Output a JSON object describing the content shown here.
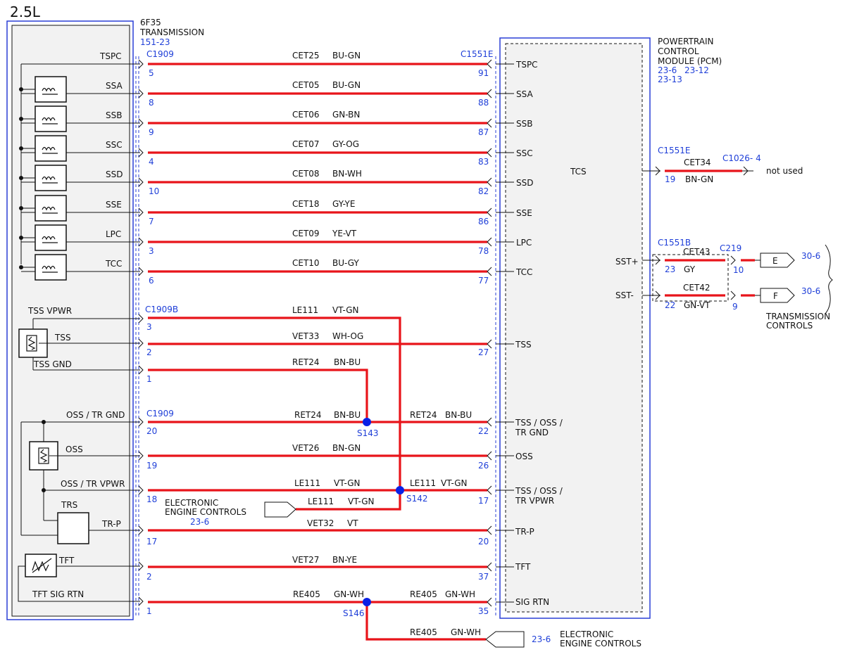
{
  "engine_label": "2.5L",
  "transmission": {
    "title": "6F35",
    "title2": "TRANSMISSION",
    "ref": "151-23"
  },
  "pcm": {
    "title": "POWERTRAIN",
    "title2": "CONTROL",
    "title3": "MODULE (PCM)",
    "ref1": "23-6",
    "ref2": "23-12",
    "ref3": "23-13",
    "tcs_label": "TCS"
  },
  "connectors": {
    "c1909_top": "C1909",
    "c1909b": "C1909B",
    "c1909_bottom": "C1909",
    "c1551e_top": "C1551E",
    "c1551e_right": "C1551E",
    "c1551b": "C1551B",
    "c1026": "C1026- 4",
    "c219": "C219"
  },
  "solenoid_wires": [
    {
      "label": "TSPC",
      "circuit": "CET25",
      "color": "BU-GN",
      "left_pin": "5",
      "right_pin": "91",
      "pcm_label": "TSPC",
      "icon": false
    },
    {
      "label": "SSA",
      "circuit": "CET05",
      "color": "BU-GN",
      "left_pin": "8",
      "right_pin": "88",
      "pcm_label": "SSA",
      "icon": true
    },
    {
      "label": "SSB",
      "circuit": "CET06",
      "color": "GN-BN",
      "left_pin": "9",
      "right_pin": "87",
      "pcm_label": "SSB",
      "icon": true
    },
    {
      "label": "SSC",
      "circuit": "CET07",
      "color": "GY-OG",
      "left_pin": "4",
      "right_pin": "83",
      "pcm_label": "SSC",
      "icon": true
    },
    {
      "label": "SSD",
      "circuit": "CET08",
      "color": "BN-WH",
      "left_pin": "10",
      "right_pin": "82",
      "pcm_label": "SSD",
      "icon": true
    },
    {
      "label": "SSE",
      "circuit": "CET18",
      "color": "GY-YE",
      "left_pin": "7",
      "right_pin": "86",
      "pcm_label": "SSE",
      "icon": true
    },
    {
      "label": "LPC",
      "circuit": "CET09",
      "color": "YE-VT",
      "left_pin": "3",
      "right_pin": "78",
      "pcm_label": "LPC",
      "icon": true
    },
    {
      "label": "TCC",
      "circuit": "CET10",
      "color": "BU-GY",
      "left_pin": "6",
      "right_pin": "77",
      "pcm_label": "TCC",
      "icon": true
    }
  ],
  "tss": {
    "vpwr_label": "TSS VPWR",
    "sensor_label": "TSS",
    "gnd_label": "TSS GND",
    "vpwr_circuit": "LE111",
    "vpwr_color": "VT-GN",
    "vpwr_pin": "3",
    "sig_circuit": "VET33",
    "sig_color": "WH-OG",
    "sig_pin": "2",
    "sig_right_pin": "27",
    "sig_pcm_label": "TSS",
    "gnd_circuit": "RET24",
    "gnd_color": "BN-BU",
    "gnd_pin": "1"
  },
  "oss": {
    "gnd_label": "OSS / TR GND",
    "gnd_pin": "20",
    "gnd_circuit_left": "RET24",
    "gnd_color_left": "BN-BU",
    "splice_s143": "S143",
    "gnd_circuit_right": "RET24",
    "gnd_color_right": "BN-BU",
    "gnd_right_pin": "22",
    "gnd_pcm_label": "TSS / OSS /",
    "gnd_pcm_label2": "TR GND",
    "sensor_label": "OSS",
    "sig_pin": "19",
    "sig_circuit": "VET26",
    "sig_color": "BN-GN",
    "sig_right_pin": "26",
    "sig_pcm_label": "OSS",
    "vpwr_label": "OSS / TR VPWR",
    "vpwr_pin": "18",
    "vpwr_circuit_left": "LE111",
    "vpwr_color_left": "VT-GN",
    "splice_s142": "S142",
    "vpwr_circuit_right": "LE111",
    "vpwr_color_right": "VT-GN",
    "vpwr_right_pin": "17",
    "vpwr_pcm_label": "TSS / OSS /",
    "vpwr_pcm_label2": "TR VPWR",
    "eec_circuit": "LE111",
    "eec_color": "VT-GN",
    "eec_label": "ELECTRONIC",
    "eec_label2": "ENGINE CONTROLS",
    "eec_ref": "23-6"
  },
  "trs": {
    "label": "TRS",
    "pin_label": "TR-P",
    "pin": "17",
    "circuit": "VET32",
    "color": "VT",
    "right_pin": "20",
    "pcm_label": "TR-P"
  },
  "tft": {
    "label": "TFT",
    "pin": "2",
    "circuit": "VET27",
    "color": "BN-YE",
    "right_pin": "37",
    "pcm_label": "TFT",
    "rtn_label": "TFT SIG RTN",
    "rtn_pin": "1",
    "rtn_circuit_left": "RE405",
    "rtn_color_left": "GN-WH",
    "splice_s146": "S146",
    "rtn_circuit_right": "RE405",
    "rtn_color_right": "GN-WH",
    "rtn_right_pin": "35",
    "rtn_pcm_label": "SIG RTN",
    "eec_circuit": "RE405",
    "eec_color": "GN-WH",
    "eec_ref": "23-6",
    "eec_label": "ELECTRONIC",
    "eec_label2": "ENGINE CONTROLS"
  },
  "tcs": {
    "circuit": "CET34",
    "color": "BN-GN",
    "pin": "19",
    "note": "not used"
  },
  "sst": {
    "plus_label": "SST+",
    "minus_label": "SST-",
    "plus_circuit": "CET43",
    "plus_color": "GY",
    "plus_pin": "23",
    "plus_c219_pin": "10",
    "minus_circuit": "CET42",
    "minus_color": "GN-VT",
    "minus_pin": "22",
    "minus_c219_pin": "9",
    "e_letter": "E",
    "f_letter": "F",
    "e_ref": "30-6",
    "f_ref": "30-6",
    "dest_label": "TRANSMISSION",
    "dest_label2": "CONTROLS"
  },
  "colors": {
    "wire": "#e8141a",
    "reference": "#1f3fd8",
    "splice": "#0a20e6",
    "module_fill": "#f2f2f2"
  }
}
